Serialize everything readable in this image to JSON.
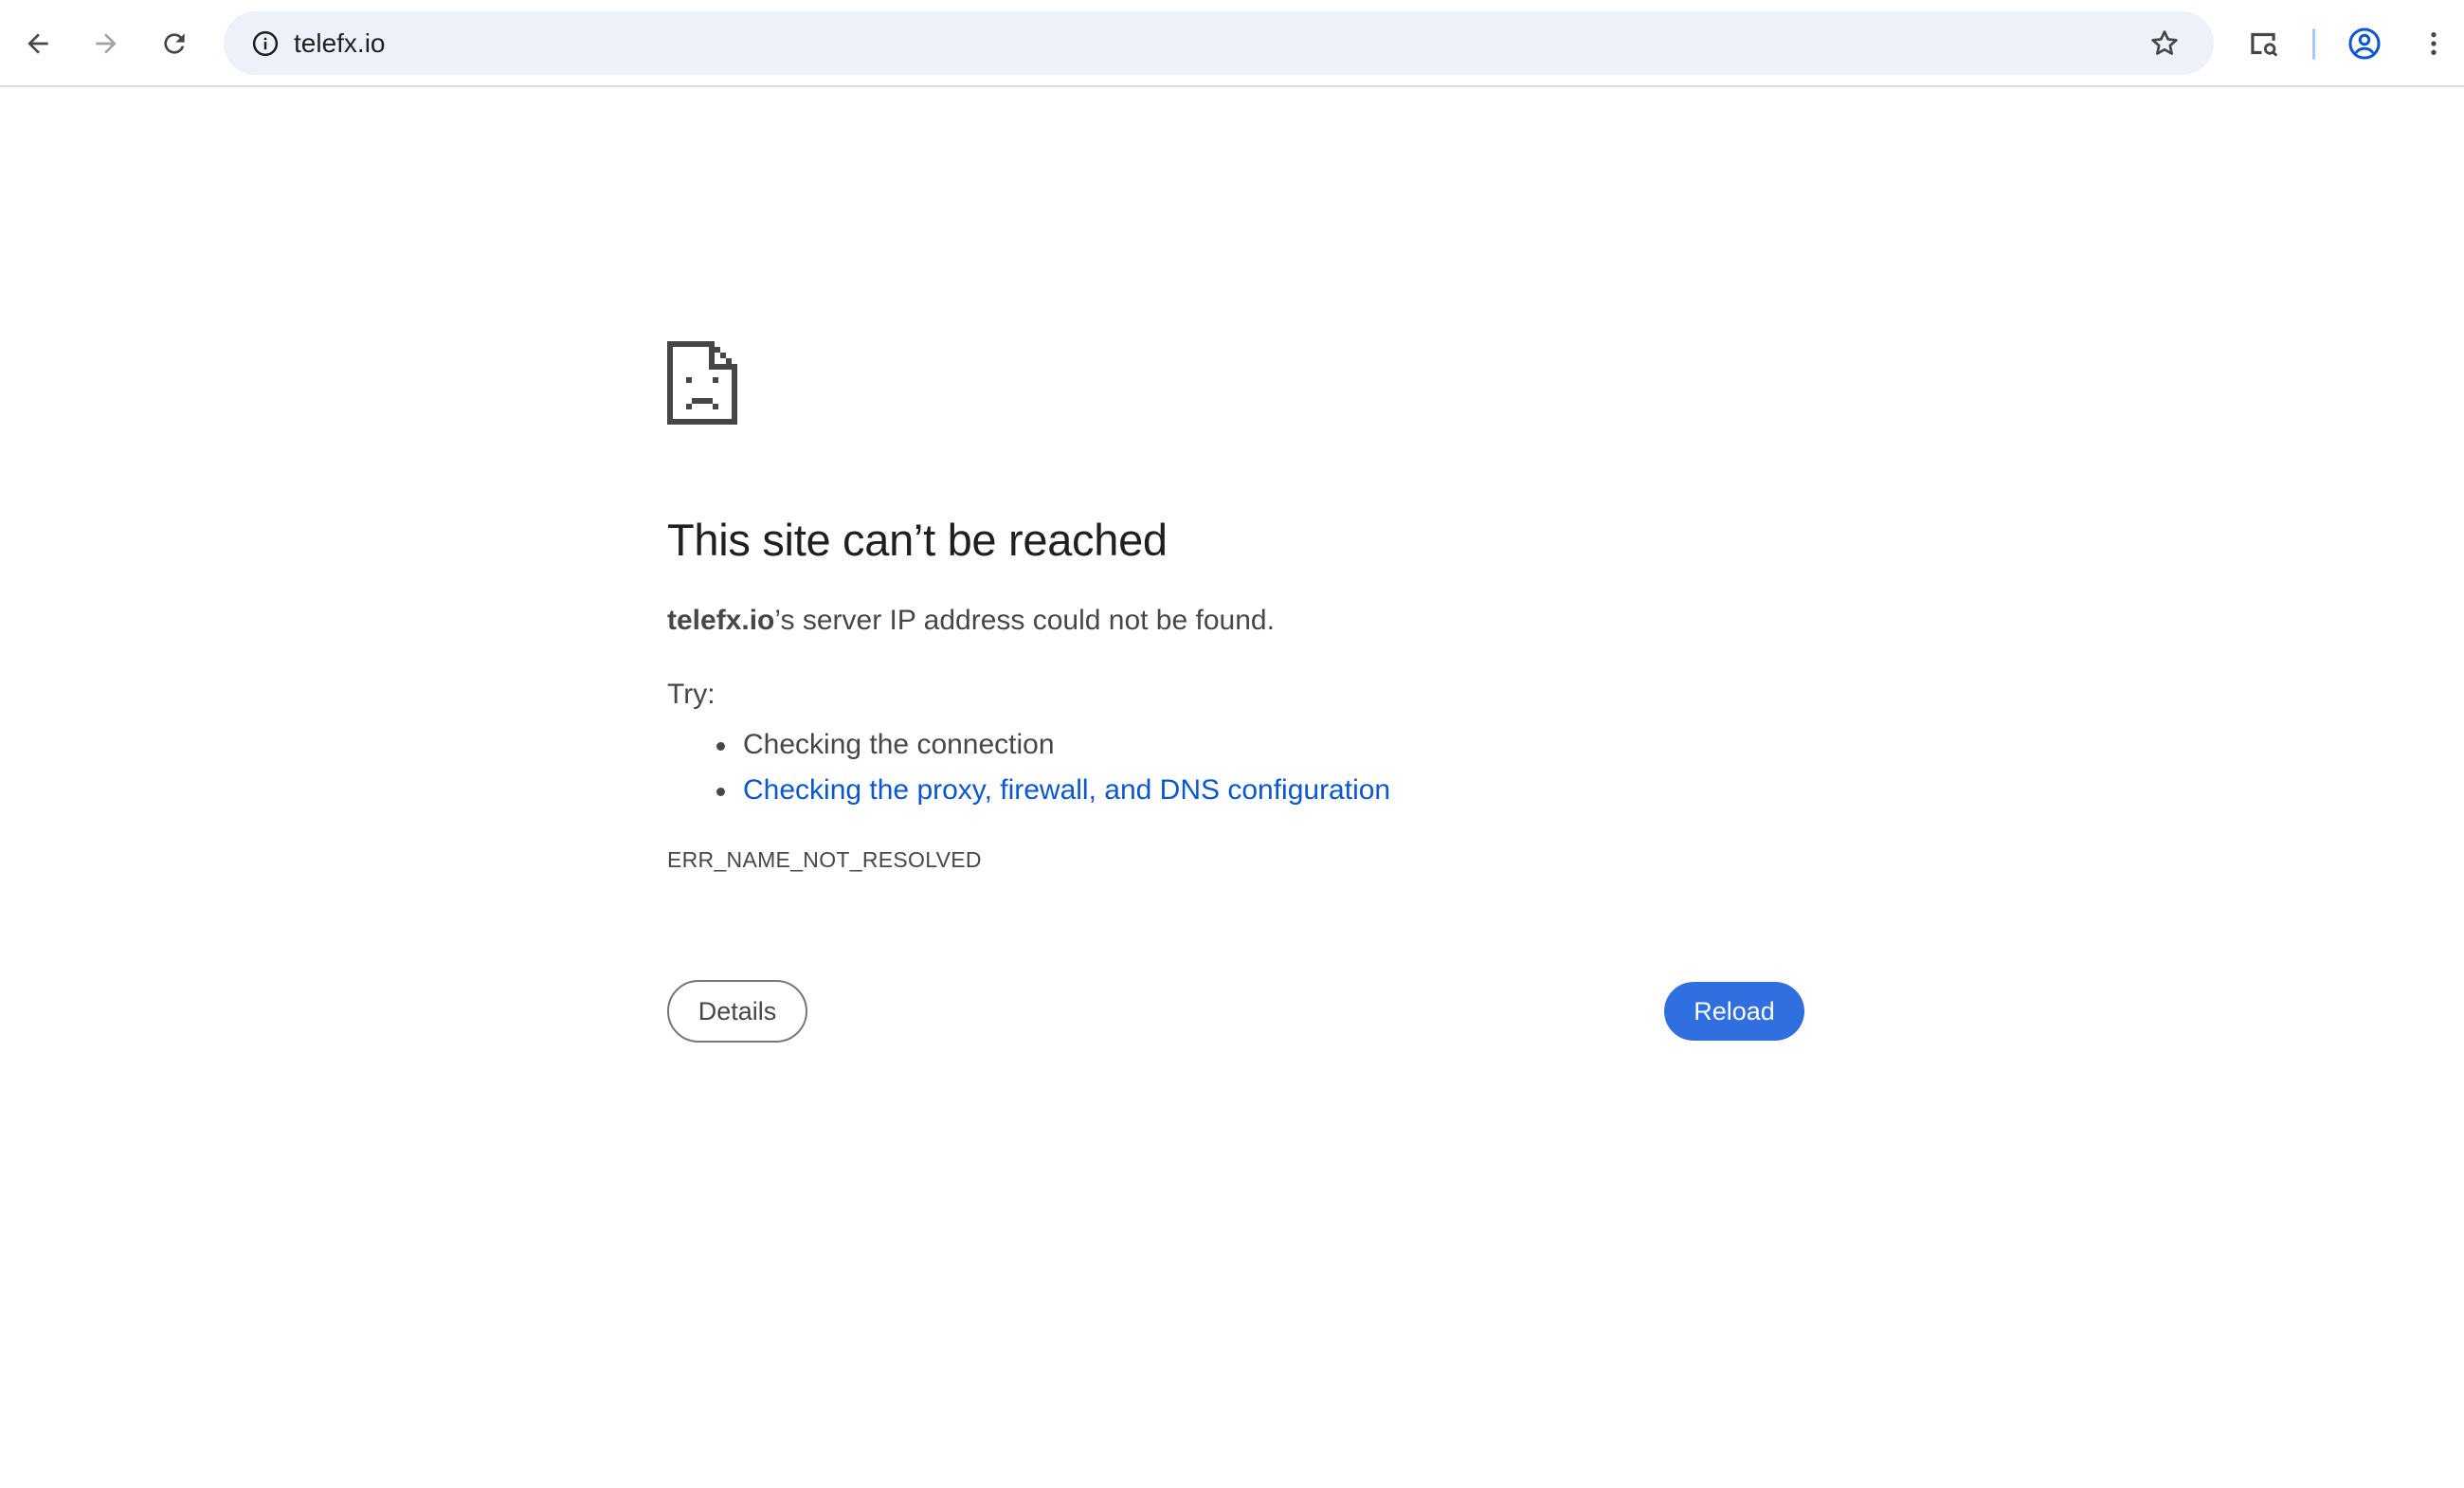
{
  "browser": {
    "url": "telefx.io",
    "icons": {
      "back": "arrow-back-icon",
      "forward": "arrow-forward-icon",
      "reload": "reload-icon",
      "site_info": "info-icon",
      "bookmark": "star-icon",
      "search_tab": "tab-search-icon",
      "profile": "account-circle-icon",
      "menu": "more-vert-icon"
    }
  },
  "error_page": {
    "icon": "sad-document-icon",
    "title": "This site can’t be reached",
    "host": "telefx.io",
    "summary_suffix": "’s server IP address could not be found.",
    "try_label": "Try:",
    "suggestions": [
      "Checking the connection",
      "Checking the proxy, firewall, and DNS configuration"
    ],
    "error_code": "ERR_NAME_NOT_RESOLVED",
    "details_label": "Details",
    "reload_label": "Reload"
  },
  "colors": {
    "accent": "#2f6fdf",
    "link": "#0b57d0",
    "omnibox_bg": "#edf2fa",
    "text": "#474747"
  }
}
